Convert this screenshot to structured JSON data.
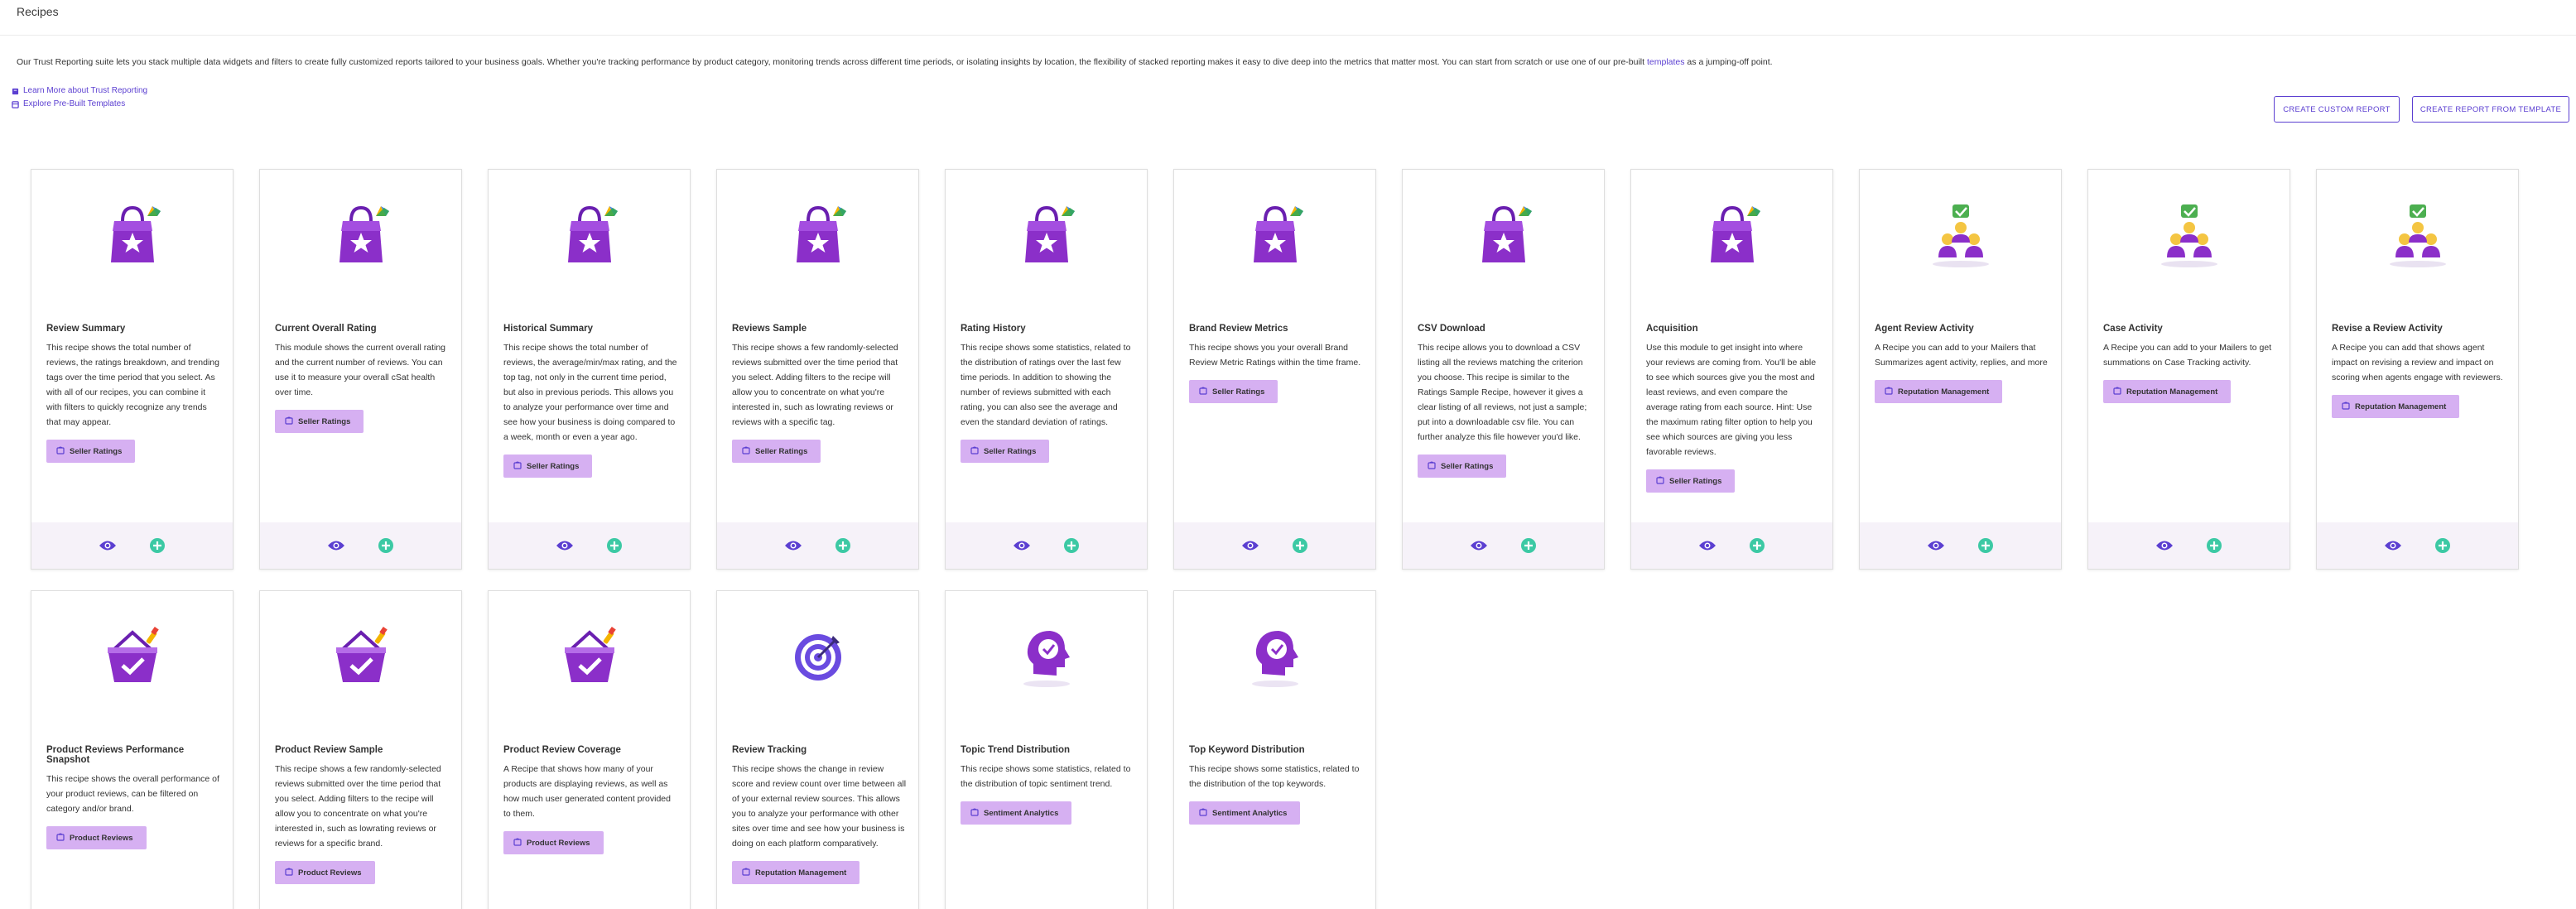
{
  "page": {
    "title": "Recipes",
    "intro_text": "Our Trust Reporting suite lets you stack multiple data widgets and filters to create fully customized reports tailored to your business goals. Whether you're tracking performance by product category, monitoring trends across different time periods, or isolating insights by location, the flexibility of stacked reporting makes it easy to dive deep into the metrics that matter most. You can start from scratch or use one of our pre-built",
    "intro_link": "templates",
    "intro_suffix": " as a jumping-off point."
  },
  "help_links": [
    {
      "label": "Learn More about Trust Reporting",
      "icon": "book-icon"
    },
    {
      "label": "Explore Pre-Built Templates",
      "icon": "template-icon"
    }
  ],
  "actions": {
    "create_custom": "CREATE CUSTOM REPORT",
    "create_from_template": "CREATE REPORT FROM TEMPLATE"
  },
  "colors": {
    "accent": "#5b3fd1",
    "tag_bg": "#d6b0f2",
    "bag_purple": "#8b2fc9",
    "footer_bg": "#f6f2f9",
    "add_green": "#3cc9a4"
  },
  "cards": [
    {
      "title": "Review Summary",
      "desc": "This recipe shows the total number of reviews, the ratings breakdown, and trending tags over the time period that you select. As with all of our recipes, you can combine it with filters to quickly recognize any trends that may appear.",
      "tag": "Seller Ratings",
      "illustration": "shopping-bag-star"
    },
    {
      "title": "Current Overall Rating",
      "desc": "This module shows the current overall rating and the current number of reviews. You can use it to measure your overall cSat health over time.",
      "tag": "Seller Ratings",
      "illustration": "shopping-bag-star"
    },
    {
      "title": "Historical Summary",
      "desc": "This recipe shows the total number of reviews, the average/min/max rating, and the top tag, not only in the current time period, but also in previous periods. This allows you to analyze your performance over time and see how your business is doing compared to a week, month or even a year ago.",
      "tag": "Seller Ratings",
      "illustration": "shopping-bag-star"
    },
    {
      "title": "Reviews Sample",
      "desc": "This recipe shows a few randomly-selected reviews submitted over the time period that you select. Adding filters to the recipe will allow you to concentrate on what you're interested in, such as lowrating reviews or reviews with a specific tag.",
      "tag": "Seller Ratings",
      "illustration": "shopping-bag-star"
    },
    {
      "title": "Rating History",
      "desc": "This recipe shows some statistics, related to the distribution of ratings over the last few time periods. In addition to showing the number of reviews submitted with each rating, you can also see the average and even the standard deviation of ratings.",
      "tag": "Seller Ratings",
      "illustration": "shopping-bag-star"
    },
    {
      "title": "Brand Review Metrics",
      "desc": "This recipe shows you your overall Brand Review Metric Ratings within the time frame.",
      "tag": "Seller Ratings",
      "illustration": "shopping-bag-star"
    },
    {
      "title": "CSV Download",
      "desc": "This recipe allows you to download a CSV listing all the reviews matching the criterion you choose. This recipe is similar to the Ratings Sample Recipe, however it gives a clear listing of all reviews, not just a sample; put into a downloadable csv file. You can further analyze this file however you'd like.",
      "tag": "Seller Ratings",
      "illustration": "shopping-bag-star"
    },
    {
      "title": "Acquisition",
      "desc": "Use this module to get insight into where your reviews are coming from. You'll be able to see which sources give you the most and least reviews, and even compare the average rating from each source. Hint: Use the maximum rating filter option to help you see which sources are giving you less favorable reviews.",
      "tag": "Seller Ratings",
      "illustration": "shopping-bag-star"
    },
    {
      "title": "Agent Review Activity",
      "desc": "A Recipe you can add to your Mailers that Summarizes agent activity, replies, and more",
      "tag": "Reputation Management",
      "illustration": "people-check"
    },
    {
      "title": "Case Activity",
      "desc": "A Recipe you can add to your Mailers to get summations on Case Tracking activity.",
      "tag": "Reputation Management",
      "illustration": "people-check"
    },
    {
      "title": "Revise a Review Activity",
      "desc": "A Recipe you can add that shows agent impact on revising a review and impact on scoring when agents engage with reviewers.",
      "tag": "Reputation Management",
      "illustration": "people-check"
    },
    {
      "title": "Product Reviews Performance Snapshot",
      "desc": "This recipe shows the overall performance of your product reviews, can be filtered on category and/or brand.",
      "tag": "Product Reviews",
      "illustration": "basket-check"
    },
    {
      "title": "Product Review Sample",
      "desc": "This recipe shows a few randomly-selected reviews submitted over the time period that you select. Adding filters to the recipe will allow you to concentrate on what you're interested in, such as lowrating reviews or reviews for a specific brand.",
      "tag": "Product Reviews",
      "illustration": "basket-check"
    },
    {
      "title": "Product Review Coverage",
      "desc": "A Recipe that shows how many of your products are displaying reviews, as well as how much user generated content provided to them.",
      "tag": "Product Reviews",
      "illustration": "basket-check"
    },
    {
      "title": "Review Tracking",
      "desc": "This recipe shows the change in review score and review count over time between all of your external review sources. This allows you to analyze your performance with other sites over time and see how your business is doing on each platform comparatively.",
      "tag": "Reputation Management",
      "illustration": "target"
    },
    {
      "title": "Topic Trend Distribution",
      "desc": "This recipe shows some statistics, related to the distribution of topic sentiment trend.",
      "tag": "Sentiment Analytics",
      "illustration": "head-check"
    },
    {
      "title": "Top Keyword Distribution",
      "desc": "This recipe shows some statistics, related to the distribution of the top keywords.",
      "tag": "Sentiment Analytics",
      "illustration": "head-check"
    }
  ]
}
